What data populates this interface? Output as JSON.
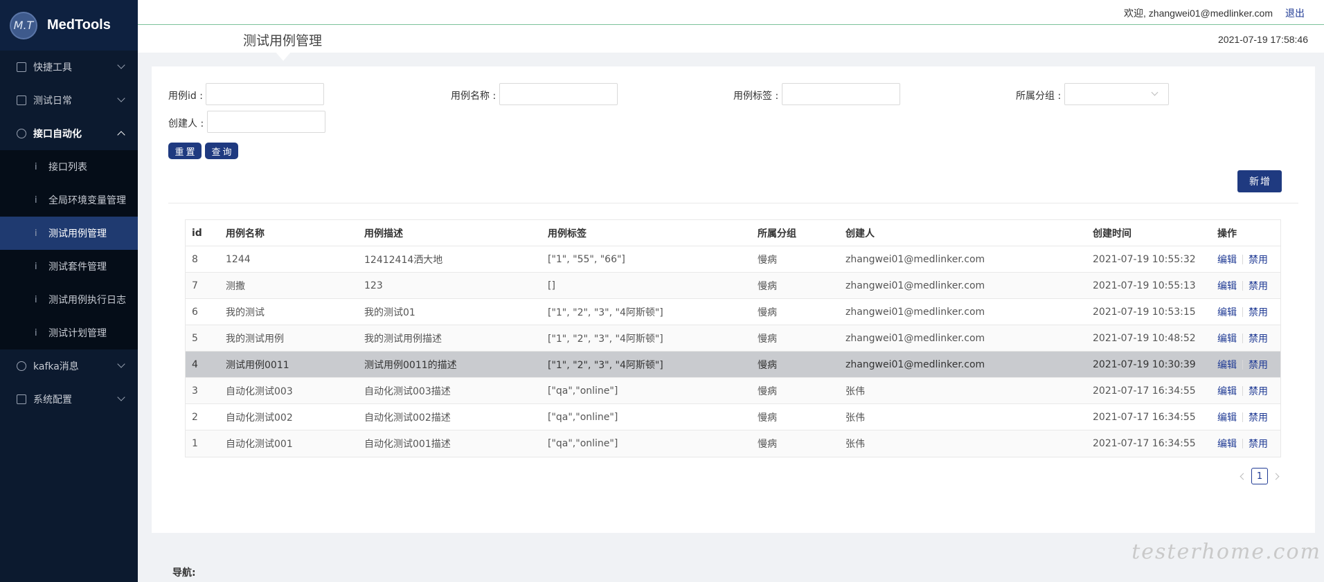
{
  "app": {
    "logo_badge": "M.T",
    "name": "MedTools"
  },
  "sidebar": {
    "items": [
      {
        "label": "快捷工具",
        "icon": "dashboard-icon"
      },
      {
        "label": "测试日常",
        "icon": "calendar-icon"
      },
      {
        "label": "接口自动化",
        "icon": "api-icon",
        "expanded": true
      },
      {
        "label": "kafka消息",
        "icon": "message-icon"
      },
      {
        "label": "系统配置",
        "icon": "settings-icon"
      }
    ],
    "sub_items": [
      {
        "label": "接口列表",
        "bullet": "i"
      },
      {
        "label": "全局环境变量管理",
        "bullet": "i"
      },
      {
        "label": "测试用例管理",
        "bullet": "i",
        "active": true
      },
      {
        "label": "测试套件管理",
        "bullet": "i"
      },
      {
        "label": "测试用例执行日志",
        "bullet": "i"
      },
      {
        "label": "测试计划管理",
        "bullet": "i"
      }
    ]
  },
  "header": {
    "welcome": "欢迎, zhangwei01@medlinker.com",
    "logout": "退出",
    "page_title": "测试用例管理",
    "datetime": "2021-07-19 17:58:46"
  },
  "filters": {
    "case_id_label": "用例id :",
    "case_id_value": "",
    "case_name_label": "用例名称 :",
    "case_name_value": "",
    "case_tag_label": "用例标签 :",
    "case_tag_value": "",
    "group_label": "所属分组 :",
    "group_value": "",
    "creator_label": "创建人 :",
    "creator_value": "",
    "reset_button": "重置",
    "query_button": "查询"
  },
  "add_button": "新增",
  "table": {
    "columns": [
      "id",
      "用例名称",
      "用例描述",
      "用例标签",
      "所属分组",
      "创建人",
      "创建时间",
      "操作"
    ],
    "rows": [
      {
        "id": "8",
        "name": "1244",
        "desc": "12412414洒大地",
        "tags": "[\"1\", \"55\", \"66\"]",
        "group": "慢病",
        "creator": "zhangwei01@medlinker.com",
        "time": "2021-07-19 10:55:32",
        "edit": "编辑",
        "disable": "禁用"
      },
      {
        "id": "7",
        "name": "测撒",
        "desc": "123",
        "tags": "[]",
        "group": "慢病",
        "creator": "zhangwei01@medlinker.com",
        "time": "2021-07-19 10:55:13",
        "edit": "编辑",
        "disable": "禁用"
      },
      {
        "id": "6",
        "name": "我的测试",
        "desc": "我的测试01",
        "tags": "[\"1\", \"2\", \"3\", \"4阿斯顿\"]",
        "group": "慢病",
        "creator": "zhangwei01@medlinker.com",
        "time": "2021-07-19 10:53:15",
        "edit": "编辑",
        "disable": "禁用"
      },
      {
        "id": "5",
        "name": "我的测试用例",
        "desc": "我的测试用例描述",
        "tags": "[\"1\", \"2\", \"3\", \"4阿斯顿\"]",
        "group": "慢病",
        "creator": "zhangwei01@medlinker.com",
        "time": "2021-07-19 10:48:52",
        "edit": "编辑",
        "disable": "禁用"
      },
      {
        "id": "4",
        "name": "测试用例0011",
        "desc": "测试用例0011的描述",
        "tags": "[\"1\", \"2\", \"3\", \"4阿斯顿\"]",
        "group": "慢病",
        "creator": "zhangwei01@medlinker.com",
        "time": "2021-07-19 10:30:39",
        "edit": "编辑",
        "disable": "禁用",
        "highlighted": true
      },
      {
        "id": "3",
        "name": "自动化测试003",
        "desc": "自动化测试003描述",
        "tags": "[\"qa\",\"online\"]",
        "group": "慢病",
        "creator": "张伟",
        "time": "2021-07-17 16:34:55",
        "edit": "编辑",
        "disable": "禁用"
      },
      {
        "id": "2",
        "name": "自动化测试002",
        "desc": "自动化测试002描述",
        "tags": "[\"qa\",\"online\"]",
        "group": "慢病",
        "creator": "张伟",
        "time": "2021-07-17 16:34:55",
        "edit": "编辑",
        "disable": "禁用"
      },
      {
        "id": "1",
        "name": "自动化测试001",
        "desc": "自动化测试001描述",
        "tags": "[\"qa\",\"online\"]",
        "group": "慢病",
        "creator": "张伟",
        "time": "2021-07-17 16:34:55",
        "edit": "编辑",
        "disable": "禁用"
      }
    ]
  },
  "pagination": {
    "current_page": "1"
  },
  "footer": {
    "nav_label": "导航:"
  },
  "watermark": "testerhome.com",
  "colors": {
    "sidebar_bg": "#0c1a2f",
    "accent": "#1f3a80",
    "link": "#1f3a94",
    "active_menu": "#1f3a70"
  }
}
